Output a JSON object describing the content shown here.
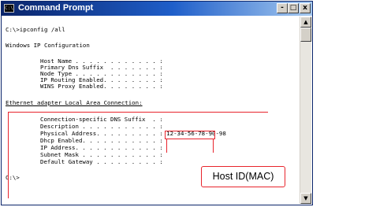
{
  "window": {
    "title": "Command Prompt",
    "icon_text": "C:\\",
    "buttons": {
      "minimize": "-",
      "maximize": "□",
      "close": "x"
    }
  },
  "console": {
    "lines": [
      "C:\\>ipconfig /all",
      "Windows IP Configuration",
      "Host Name . . . . . . . . . . . . :",
      "Primary Dns Suffix  . . . . . . . :",
      "Node Type . . . . . . . . . . . . :",
      "IP Routing Enabled. . . . . . . . :",
      "WINS Proxy Enabled. . . . . . . . :",
      "Ethernet adapter Local Area Connection:",
      "Connection-specific DNS Suffix  . :",
      "Description . . . . . . . . . . . :",
      "Physical Address. . . . . . . . . : 12-34-56-78-90-98",
      "Dhcp Enabled. . . . . . . . . . . :",
      "IP Address. . . . . . . . . . . . :",
      "Subnet Mask . . . . . . . . . . . :",
      "Default Gateway . . . . . . . . . :",
      "C:\\>"
    ]
  },
  "scrollbar": {
    "up_arrow": "▲",
    "down_arrow": "▼"
  },
  "annotation": {
    "callout_label": "Host ID(MAC)",
    "highlight_color": "#e8242c"
  }
}
